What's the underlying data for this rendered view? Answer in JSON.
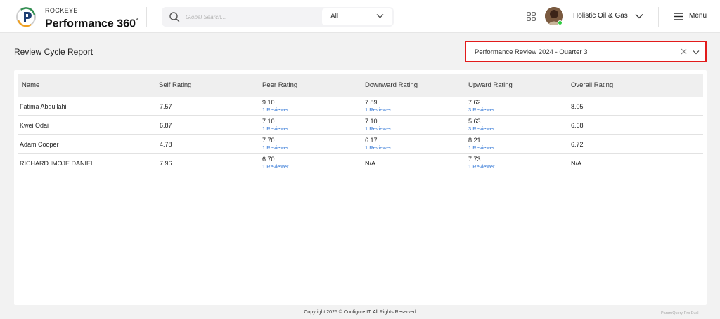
{
  "header": {
    "brand_small": "ROCKEYE",
    "brand_big": "Performance 360",
    "brand_sup": "°",
    "search_placeholder": "Global Search...",
    "search_scope": "All",
    "org_name": "Holistic Oil & Gas",
    "menu_label": "Menu"
  },
  "page": {
    "title": "Review Cycle Report",
    "review_cycle": "Performance Review 2024 - Quarter 3"
  },
  "table": {
    "columns": [
      "Name",
      "Self Rating",
      "Peer Rating",
      "Downward Rating",
      "Upward Rating",
      "Overall Rating"
    ],
    "rows": [
      {
        "name": "Fatima Abdullahi",
        "self": "7.57",
        "peer": "9.10",
        "peer_sub": "1 Reviewer",
        "downward": "7.89",
        "downward_sub": "1 Reviewer",
        "upward": "7.62",
        "upward_sub": "3 Reviewer",
        "overall": "8.05"
      },
      {
        "name": "Kwei Odai",
        "self": "6.87",
        "peer": "7.10",
        "peer_sub": "1 Reviewer",
        "downward": "7.10",
        "downward_sub": "1 Reviewer",
        "upward": "5.63",
        "upward_sub": "3 Reviewer",
        "overall": "6.68"
      },
      {
        "name": "Adam Cooper",
        "self": "4.78",
        "peer": "7.70",
        "peer_sub": "1 Reviewer",
        "downward": "6.17",
        "downward_sub": "1 Reviewer",
        "upward": "8.21",
        "upward_sub": "1 Reviewer",
        "overall": "6.72"
      },
      {
        "name": "RICHARD IMOJE DANIEL",
        "self": "7.96",
        "peer": "6.70",
        "peer_sub": "1 Reviewer",
        "downward": "N/A",
        "upward": "7.73",
        "upward_sub": "1 Reviewer",
        "overall": "N/A"
      }
    ]
  },
  "footer": {
    "copyright": "Copyright 2025 © Configure.IT. All Rights Reserved",
    "watermark": "ParamQuery Pro Eval"
  },
  "colors": {
    "accent_red": "#e21b1b",
    "link_blue": "#3b7dd8",
    "online_green": "#2ecc40"
  },
  "icons": [
    "rockeye-logo-icon",
    "search-icon",
    "chevron-down-icon",
    "apps-grid-icon",
    "avatar",
    "online-status-icon",
    "hamburger-menu-icon",
    "clear-icon"
  ]
}
